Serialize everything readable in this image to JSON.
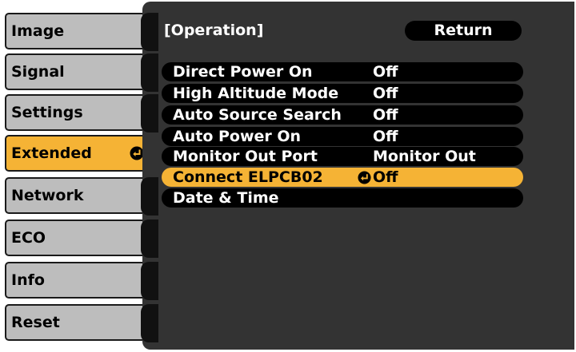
{
  "sidebar": {
    "items": [
      {
        "label": "Image"
      },
      {
        "label": "Signal"
      },
      {
        "label": "Settings"
      },
      {
        "label": "Extended",
        "active": true
      },
      {
        "label": "Network"
      },
      {
        "label": "ECO"
      },
      {
        "label": "Info"
      },
      {
        "label": "Reset"
      }
    ]
  },
  "panel": {
    "title": "[Operation]",
    "return_label": "Return",
    "rows": [
      {
        "label": "Direct Power On",
        "value": "Off"
      },
      {
        "label": "High Altitude Mode",
        "value": "Off"
      },
      {
        "label": "Auto Source Search",
        "value": "Off"
      },
      {
        "label": "Auto Power On",
        "value": "Off"
      },
      {
        "label": "Monitor Out Port",
        "value": "Monitor Out"
      },
      {
        "label": "Connect ELPCB02",
        "value": "Off",
        "selected": true
      },
      {
        "label": "Date & Time",
        "value": ""
      }
    ]
  },
  "icons": {
    "enter": "enter-icon"
  },
  "colors": {
    "accent": "#f5b335",
    "sidebar_item": "#bdbdbd",
    "panel_bg": "#333333",
    "row_bg": "#000000",
    "text_light": "#ffffff"
  }
}
